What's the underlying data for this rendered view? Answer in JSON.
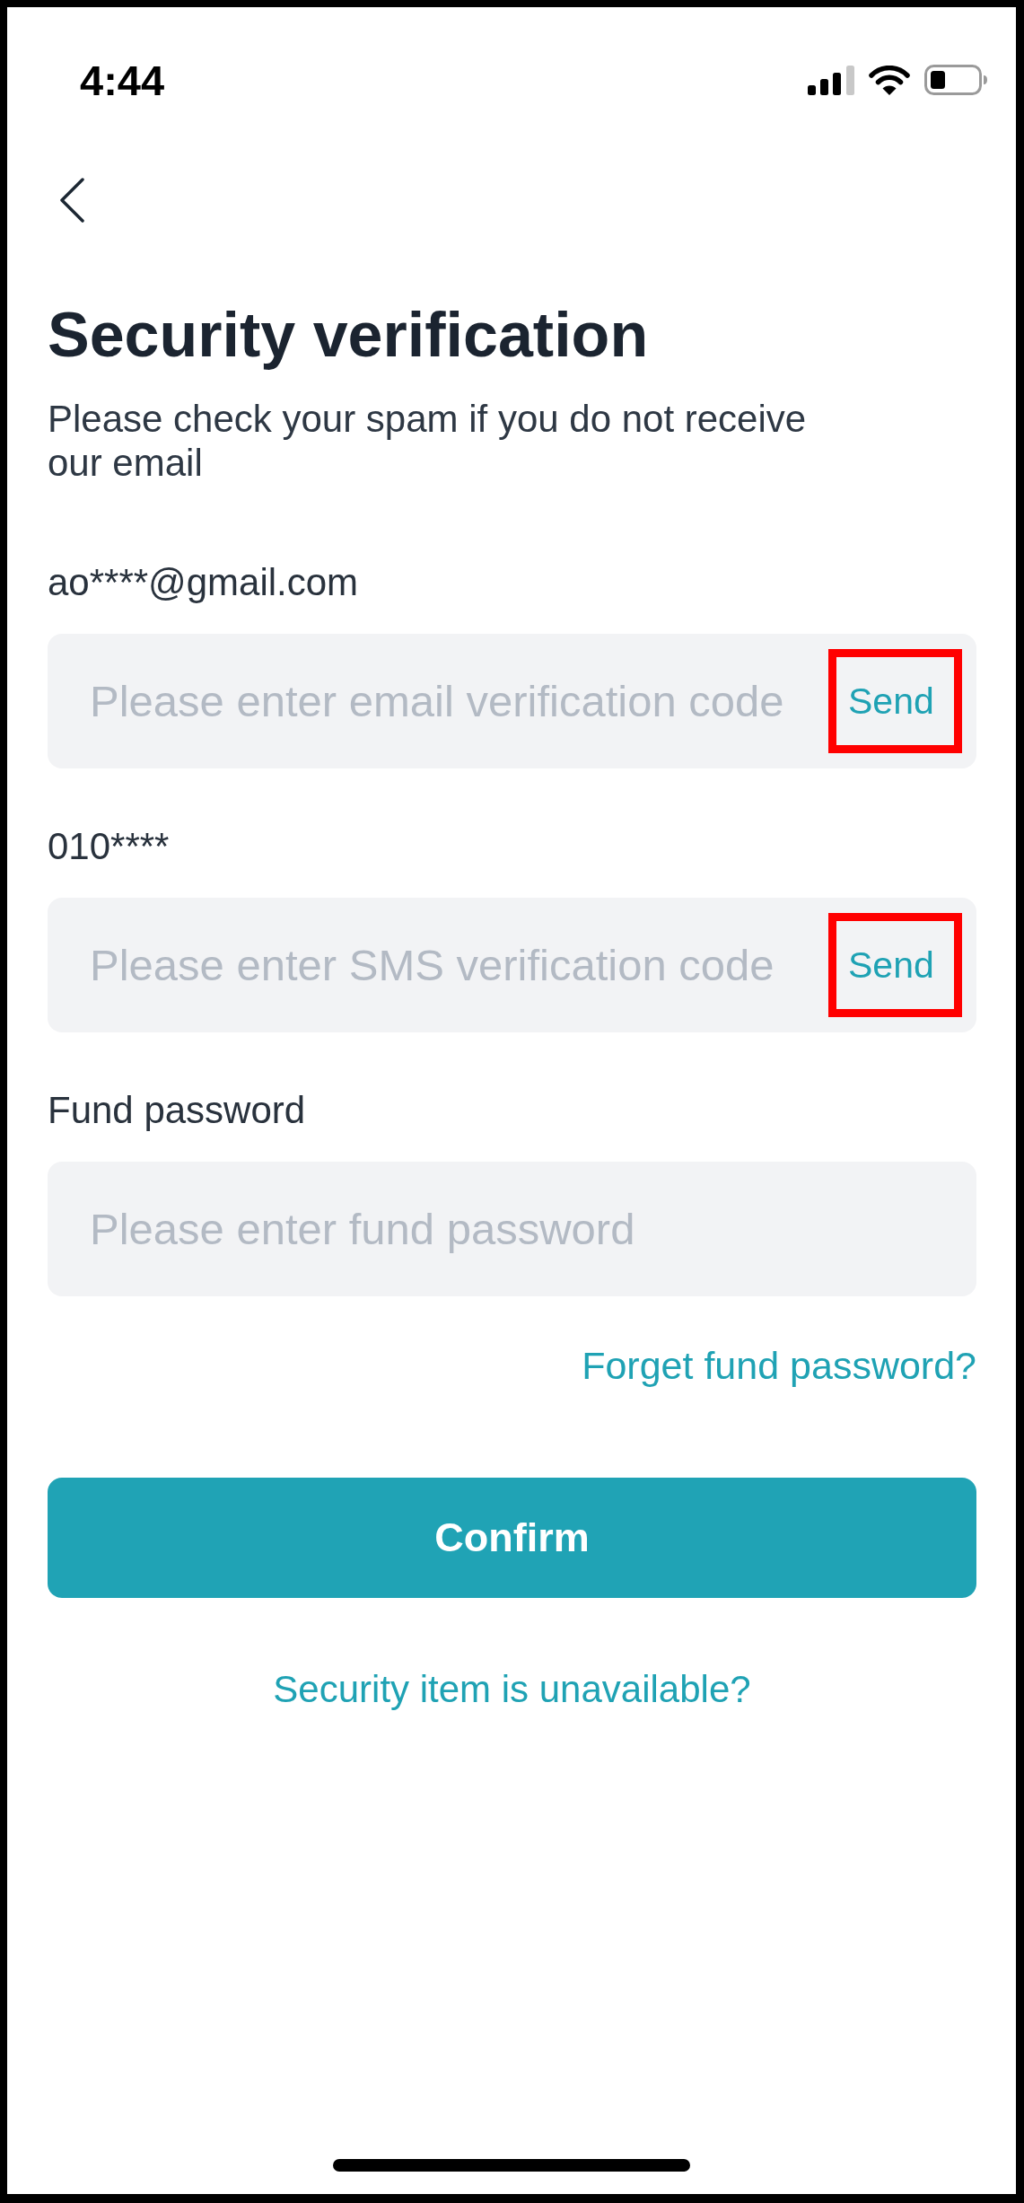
{
  "status_bar": {
    "time": "4:44"
  },
  "title": "Security verification",
  "subtitle": "Please check your spam if you do not receive our email",
  "fields": [
    {
      "kind": "code",
      "label": "ao****@gmail.com",
      "placeholder": "Please enter email verification code",
      "send_button": {
        "label": "Send",
        "highlighted": true
      }
    },
    {
      "kind": "code",
      "label": "010****",
      "placeholder": "Please enter SMS verification code",
      "send_button": {
        "label": "Send",
        "highlighted": true
      }
    },
    {
      "kind": "password",
      "label": "Fund password",
      "placeholder": "Please enter fund password"
    }
  ],
  "forgot_link": "Forget fund password?",
  "confirm_button": "Confirm",
  "unavailable_link": "Security item is unavailable?"
}
